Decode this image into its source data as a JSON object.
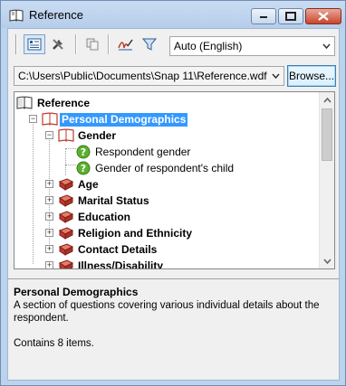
{
  "window": {
    "title": "Reference",
    "buttons": {
      "minimize": "minimize",
      "maximize": "maximize",
      "close": "close"
    }
  },
  "toolbar": {
    "buttons": [
      "view-mode-icon",
      "tools-icon",
      "copy-icon",
      "signature-icon",
      "filter-icon"
    ],
    "language_value": "Auto (English)"
  },
  "path": {
    "value": "C:\\Users\\Public\\Documents\\Snap 11\\Reference.wdf",
    "browse_label": "Browse..."
  },
  "tree": {
    "root": "Reference",
    "items": [
      {
        "label": "Personal Demographics",
        "selected": true
      },
      {
        "label": "Gender"
      },
      {
        "label": "Respondent gender"
      },
      {
        "label": "Gender of respondent's child"
      },
      {
        "label": "Age"
      },
      {
        "label": "Marital Status"
      },
      {
        "label": "Education"
      },
      {
        "label": "Religion and Ethnicity"
      },
      {
        "label": "Contact Details"
      },
      {
        "label": "Illness/Disability"
      }
    ]
  },
  "description": {
    "title": "Personal Demographics",
    "text": "A section of questions covering various individual details about the respondent.",
    "count": "Contains 8 items."
  },
  "colors": {
    "selection": "#3399ff",
    "book_red": "#c0392b",
    "question_green": "#5cb02e"
  }
}
